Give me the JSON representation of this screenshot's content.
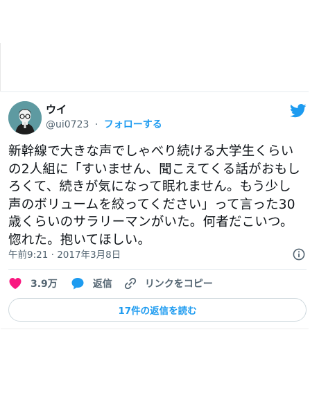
{
  "tweet": {
    "author": {
      "display_name": "ウイ",
      "handle": "@ui0723",
      "follow_label": "フォローする",
      "separator": "·"
    },
    "text": "新幹線で大きな声でしゃべり続ける大学生くらいの2人組に「すいません、聞こえてくる話がおもしろくて、続きが気になって眠れません。もう少し声のボリュームを絞ってください」って言った30歳くらいのサラリーマンがいた。何者だこいつ。惚れた。抱いてほしい。",
    "timestamp": "午前9:21 · 2017年3月8日",
    "likes": "3.9万",
    "reply_label": "返信",
    "copy_link_label": "リンクをコピー",
    "read_replies_label": "17件の返信を読む"
  },
  "icons": {
    "brand": "twitter-bird-icon",
    "like": "heart-icon",
    "reply": "speech-bubble-icon",
    "copy": "link-icon",
    "info": "info-icon"
  },
  "colors": {
    "accent": "#1d9bf0",
    "like": "#f91880",
    "text": "#0f1419",
    "secondary": "#536471",
    "avatar_bg": "#5e9aa1"
  }
}
